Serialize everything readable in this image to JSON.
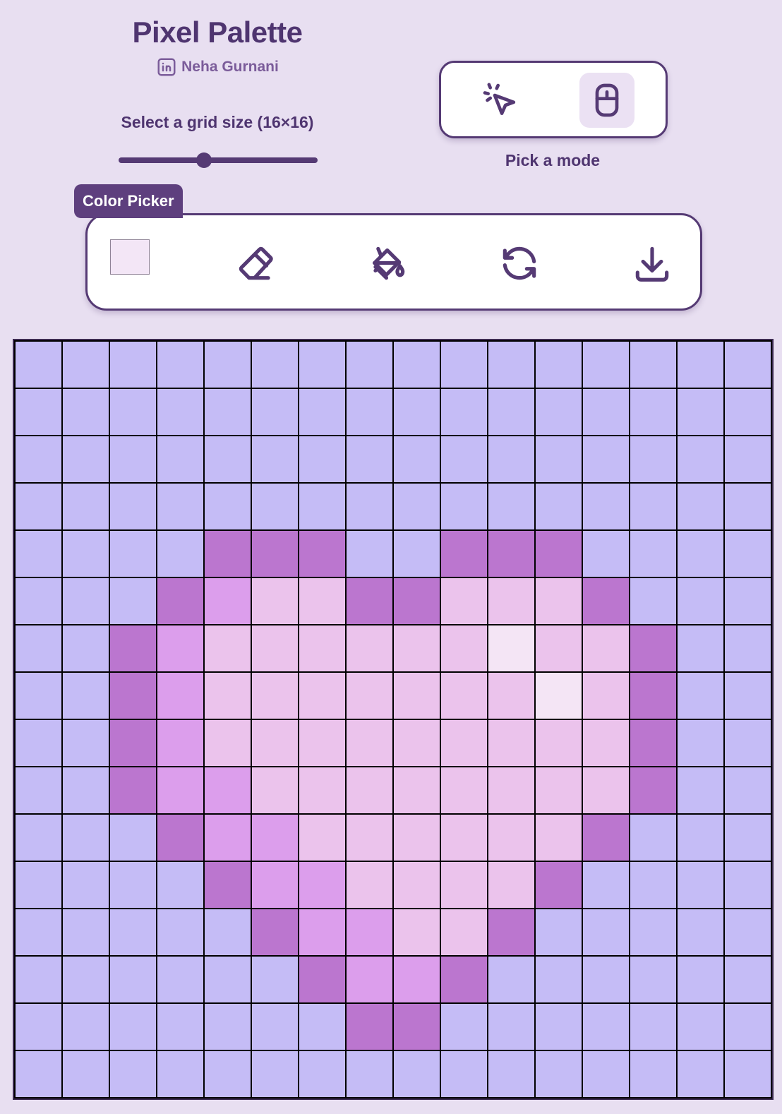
{
  "app": {
    "title": "Pixel Palette",
    "author": "Neha Gurnani"
  },
  "grid_control": {
    "label": "Select a grid size (16×16)",
    "value": 16,
    "min": 4,
    "max": 32
  },
  "mode": {
    "label": "Pick a mode",
    "options": [
      {
        "icon": "click-cursor-icon",
        "name": "click",
        "active": false
      },
      {
        "icon": "mouse-icon",
        "name": "hover",
        "active": true
      }
    ]
  },
  "toolbar": {
    "color_picker_label": "Color Picker",
    "selected_color": "#f3e6f6",
    "tools": [
      {
        "icon": "eraser-icon",
        "name": "eraser"
      },
      {
        "icon": "paint-bucket-icon",
        "name": "fill"
      },
      {
        "icon": "refresh-icon",
        "name": "reset"
      },
      {
        "icon": "download-icon",
        "name": "download"
      }
    ]
  },
  "colors": {
    "background": "#e8dff1",
    "accent": "#553a74",
    "palette": {
      "L": "#c5bcf6",
      "D": "#bb76cf",
      "M": "#dc9eec",
      "P": "#ebc3ec",
      "W": "#f4e5f5"
    }
  },
  "pixel_grid": {
    "size": 16,
    "rows": [
      "LLLLLLLLLLLLLLLL",
      "LLLLLLLLLLLLLLLL",
      "LLLLLLLLLLLLLLLL",
      "LLLLLLLLLLLLLLLL",
      "LLLLDDDLLDDDLLLL",
      "LLLDMPPDDPPPDLLL",
      "LLDMPPPPPPWPPDLL",
      "LLDMPPPPPPPWPDLL",
      "LLDMPPPPPPPPPDLL",
      "LLDMMPPPPPPPPDLL",
      "LLLDMMPPPPPPDLLL",
      "LLLLDMMPPPPDLLLL",
      "LLLLLDMMPPDLLLLL",
      "LLLLLLDMMDLLLLLL",
      "LLLLLLLDDLLLLLLL",
      "LLLLLLLLLLLLLLLL"
    ]
  }
}
